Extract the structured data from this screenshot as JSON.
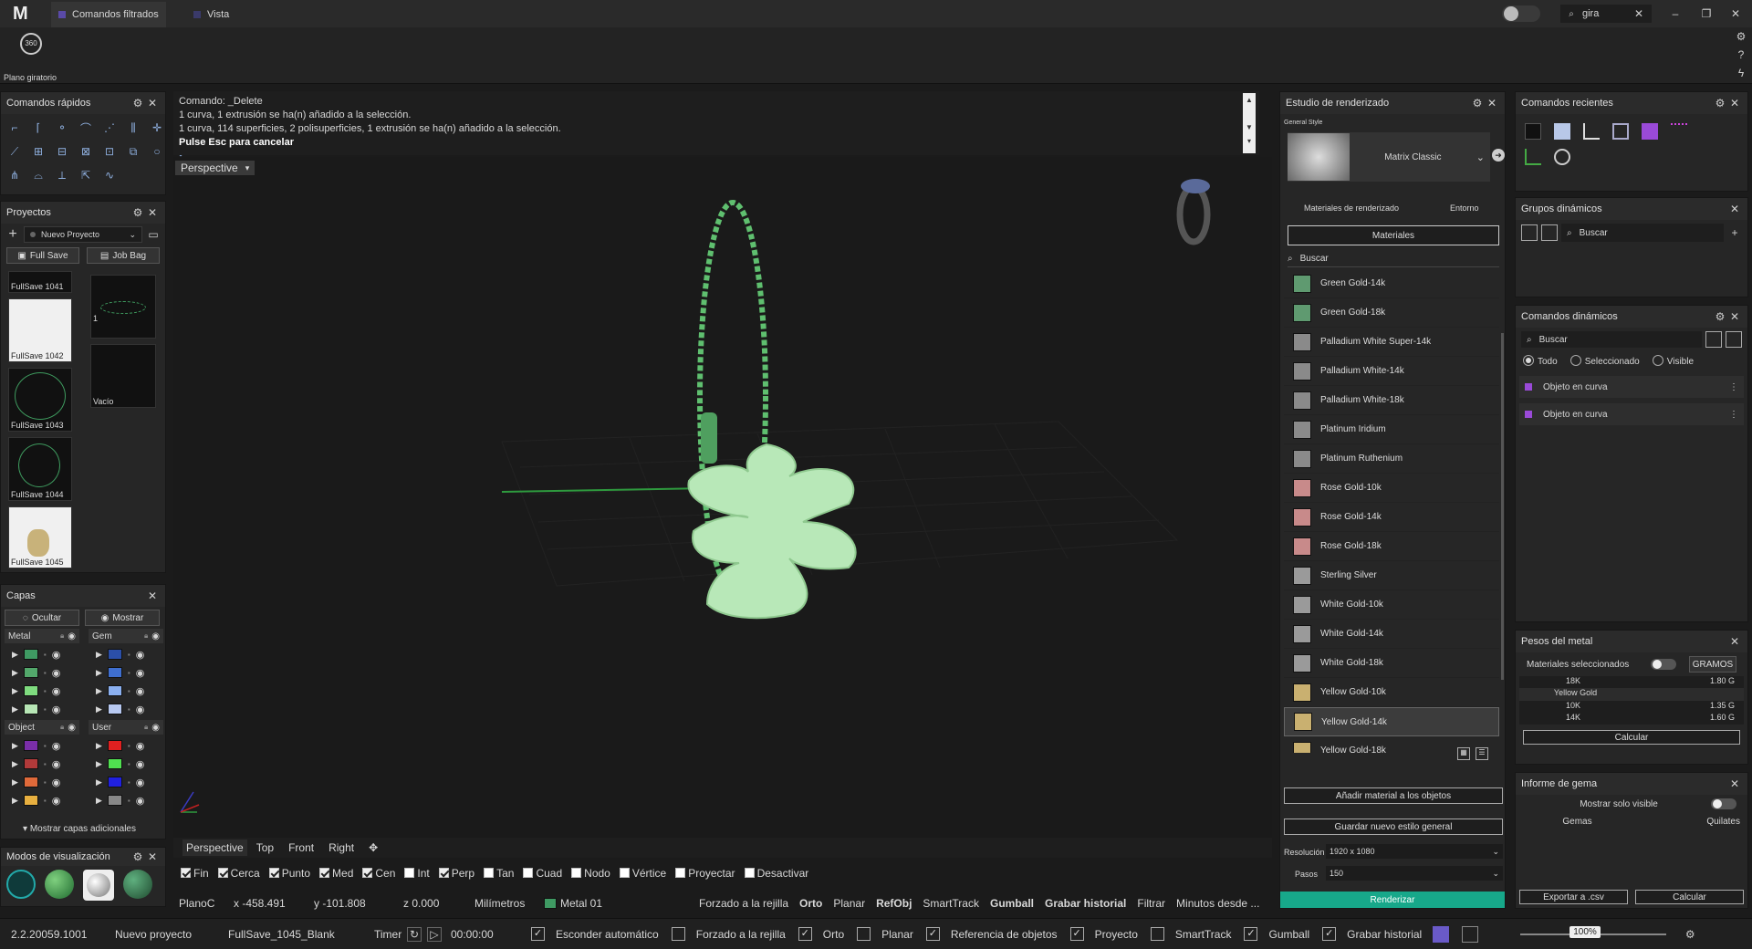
{
  "titlebar": {
    "tabs": [
      {
        "label": "Comandos filtrados"
      },
      {
        "label": "Vista"
      }
    ],
    "search_value": "gira"
  },
  "toolbar": {
    "tool_label": "Plano giratorio"
  },
  "quick_commands": {
    "title": "Comandos rápidos"
  },
  "projects": {
    "title": "Proyectos",
    "project_select": "Nuevo Proyecto",
    "full_save": "Full Save",
    "job_bag": "Job Bag",
    "thumbs": [
      {
        "label": "FullSave 1041"
      },
      {
        "label": "FullSave 1042"
      },
      {
        "label": "FullSave 1043"
      },
      {
        "label": "FullSave 1044"
      },
      {
        "label": "FullSave 1045"
      },
      {
        "label": "1"
      },
      {
        "label": "Vacío"
      }
    ]
  },
  "layers": {
    "title": "Capas",
    "hide": "Ocultar",
    "show": "Mostrar",
    "groups": [
      "Metal",
      "Gem",
      "Object",
      "User"
    ],
    "more": "Mostrar capas adicionales",
    "metal_colors": [
      "#3f9a63",
      "#53a86b",
      "#7fdc7f",
      "#b7e6b5"
    ],
    "gem_colors": [
      "#2b4fa8",
      "#3f6fd0",
      "#8bb0f0",
      "#b7c8f0"
    ],
    "object_colors": [
      "#7a2ea8",
      "#b23a3a",
      "#e06a3a",
      "#e8b040"
    ],
    "user_colors": [
      "#e02020",
      "#50e050",
      "#2020e0",
      "#888888"
    ]
  },
  "view_modes": {
    "title": "Modos de visualización"
  },
  "command_line": {
    "line1": "Comando: _Delete",
    "line2": "1 curva, 1 extrusión se ha(n) añadido a la selección.",
    "line3": "1 curva, 114 superficies, 2 polisuperficies, 1 extrusión se ha(n) añadido a la selección.",
    "line4": "Pulse Esc para cancelar"
  },
  "viewport": {
    "label": "Perspective",
    "tabs": [
      "Perspective",
      "Top",
      "Front",
      "Right"
    ]
  },
  "osnaps": [
    {
      "label": "Fin",
      "on": true
    },
    {
      "label": "Cerca",
      "on": true
    },
    {
      "label": "Punto",
      "on": true
    },
    {
      "label": "Med",
      "on": true
    },
    {
      "label": "Cen",
      "on": true
    },
    {
      "label": "Int",
      "on": false
    },
    {
      "label": "Perp",
      "on": true
    },
    {
      "label": "Tan",
      "on": false
    },
    {
      "label": "Cuad",
      "on": false
    },
    {
      "label": "Nodo",
      "on": false
    },
    {
      "label": "Vértice",
      "on": false
    },
    {
      "label": "Proyectar",
      "on": false
    },
    {
      "label": "Desactivar",
      "on": false
    }
  ],
  "statusbar": {
    "plane": "PlanoC",
    "x": "x -458.491",
    "y": "y -101.808",
    "z": "z 0.000",
    "units": "Milímetros",
    "layer": "Metal 01",
    "items": [
      "Forzado a la rejilla",
      "Orto",
      "Planar",
      "RefObj",
      "SmartTrack",
      "Gumball",
      "Grabar historial",
      "Filtrar",
      "Minutos desde ..."
    ]
  },
  "bottombar": {
    "version": "2.2.20059.1001",
    "project": "Nuevo proyecto",
    "file": "FullSave_1045_Blank",
    "timer": "Timer",
    "time": "00:00:00",
    "toggles": [
      {
        "label": "Esconder automático",
        "on": true
      },
      {
        "label": "Forzado a la rejilla",
        "on": false
      },
      {
        "label": "Orto",
        "on": true
      },
      {
        "label": "Planar",
        "on": false
      },
      {
        "label": "Referencia de objetos",
        "on": true
      },
      {
        "label": "Proyecto",
        "on": true
      },
      {
        "label": "SmartTrack",
        "on": false
      },
      {
        "label": "Gumball",
        "on": true
      },
      {
        "label": "Grabar historial",
        "on": true
      }
    ],
    "zoom": "100%"
  },
  "render_studio": {
    "title": "Estudio de renderizado",
    "general_style": "General Style",
    "style_name": "Matrix Classic",
    "tab_materials": "Materiales de renderizado",
    "tab_env": "Entorno",
    "materials_btn": "Materiales",
    "search_placeholder": "Buscar",
    "materials": [
      {
        "name": "Green Gold-14k",
        "color": "#5f9a70"
      },
      {
        "name": "Green Gold-18k",
        "color": "#5f9a70"
      },
      {
        "name": "Palladium White Super-14k",
        "color": "#8a8a8a"
      },
      {
        "name": "Palladium White-14k",
        "color": "#8a8a8a"
      },
      {
        "name": "Palladium White-18k",
        "color": "#8a8a8a"
      },
      {
        "name": "Platinum Iridium",
        "color": "#8a8a8a"
      },
      {
        "name": "Platinum Ruthenium",
        "color": "#8a8a8a"
      },
      {
        "name": "Rose Gold-10k",
        "color": "#c88a8a"
      },
      {
        "name": "Rose Gold-14k",
        "color": "#c88a8a"
      },
      {
        "name": "Rose Gold-18k",
        "color": "#c88a8a"
      },
      {
        "name": "Sterling Silver",
        "color": "#9a9a9a"
      },
      {
        "name": "White Gold-10k",
        "color": "#9a9a9a"
      },
      {
        "name": "White Gold-14k",
        "color": "#9a9a9a"
      },
      {
        "name": "White Gold-18k",
        "color": "#9a9a9a"
      },
      {
        "name": "Yellow Gold-10k",
        "color": "#c9b070"
      },
      {
        "name": "Yellow Gold-14k",
        "color": "#c9b070"
      },
      {
        "name": "Yellow Gold-18k",
        "color": "#c9b070"
      }
    ],
    "add_material": "Añadir material a los objetos",
    "save_style": "Guardar nuevo estilo general",
    "resolution_label": "Resolución",
    "resolution_value": "1920 x 1080",
    "steps_label": "Pasos",
    "steps_value": "150",
    "render_btn": "Renderizar"
  },
  "recent_commands": {
    "title": "Comandos recientes"
  },
  "dynamic_groups": {
    "title": "Grupos dinámicos",
    "search_placeholder": "Buscar"
  },
  "dynamic_commands": {
    "title": "Comandos dinámicos",
    "search_placeholder": "Buscar",
    "radios": [
      "Todo",
      "Seleccionado",
      "Visible"
    ],
    "items": [
      "Objeto en curva",
      "Objeto en curva"
    ]
  },
  "metal_weights": {
    "title": "Pesos del metal",
    "selected_label": "Materiales seleccionados",
    "unit_btn": "GRAMOS",
    "rows": [
      {
        "k": "18K",
        "v": "1.80 G"
      },
      {
        "k": "Yellow Gold",
        "v": ""
      },
      {
        "k": "10K",
        "v": "1.35 G"
      },
      {
        "k": "14K",
        "v": "1.60 G"
      }
    ],
    "calc_btn": "Calcular"
  },
  "gem_report": {
    "title": "Informe de gema",
    "visible_only": "Mostrar solo visible",
    "col_gems": "Gemas",
    "col_carats": "Quilates",
    "export_btn": "Exportar a .csv",
    "calc_btn": "Calcular"
  }
}
